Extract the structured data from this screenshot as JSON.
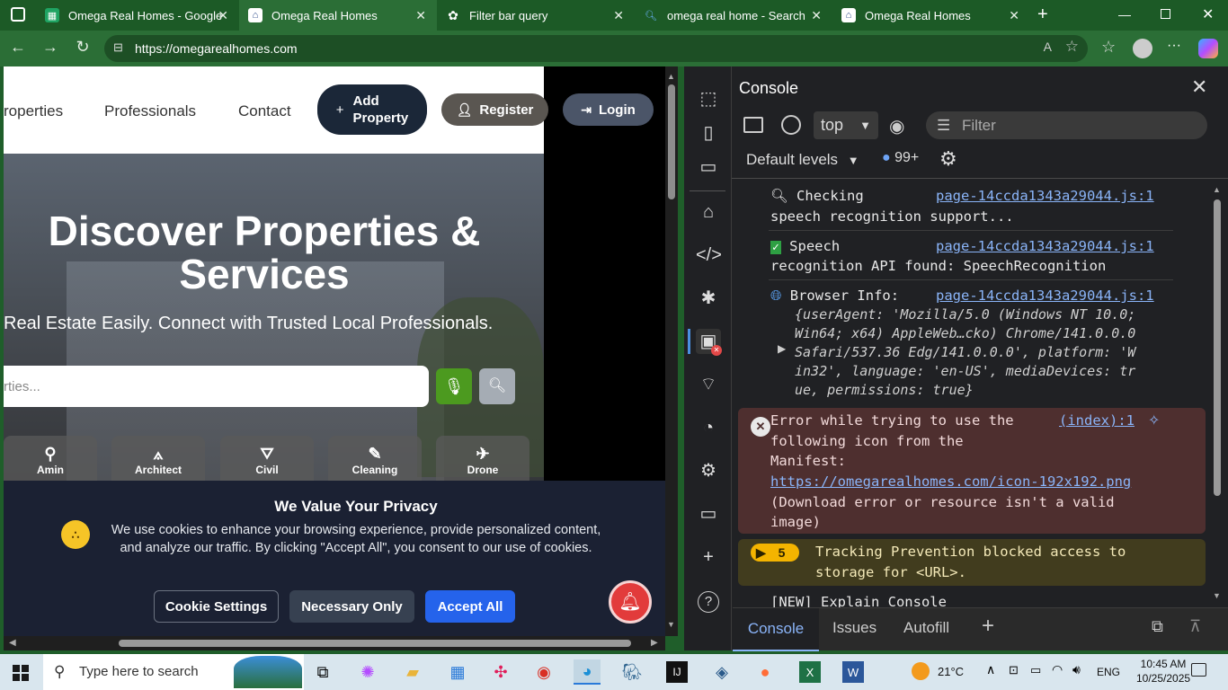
{
  "browser": {
    "tabs": [
      {
        "label": "Omega Real Homes - Google",
        "icon": "sheets-icon"
      },
      {
        "label": "Omega Real Homes",
        "icon": "site-icon"
      },
      {
        "label": "Filter bar query",
        "icon": "chatgpt-icon"
      },
      {
        "label": "omega real home - Search",
        "icon": "search-icon"
      },
      {
        "label": "Omega Real Homes",
        "icon": "site-icon"
      }
    ],
    "url": "https://omegarealhomes.com"
  },
  "site": {
    "nav": {
      "properties": "roperties",
      "professionals": "Professionals",
      "contact": "Contact",
      "add_property_line1": "Add",
      "add_property_line2": "Property",
      "register": "Register",
      "login": "Login"
    },
    "hero": {
      "title_line1": "Discover Properties &",
      "title_line2": "Services",
      "subtitle": "Real Estate Easily. Connect with Trusted Local Professionals.",
      "search_placeholder": "rties..."
    },
    "categories": [
      "Amin",
      "Architect",
      "Civil",
      "Cleaning",
      "Drone"
    ],
    "cookie": {
      "title": "We Value Your Privacy",
      "text": "We use cookies to enhance your browsing experience, provide personalized content, and analyze our traffic. By clicking \"Accept All\", you consent to our use of cookies.",
      "settings": "Cookie Settings",
      "necessary": "Necessary Only",
      "accept": "Accept All"
    }
  },
  "devtools": {
    "title": "Console",
    "context": "top",
    "filter_placeholder": "Filter",
    "levels": "Default levels",
    "count": "99+",
    "logs": {
      "l1_text": "Checking",
      "l1_src": "page-14ccda1343a29044.js:1",
      "l1_cont": "speech recognition support...",
      "l2_text": "Speech",
      "l2_src": "page-14ccda1343a29044.js:1",
      "l2_cont": "recognition API found: SpeechRecognition",
      "l3_text": "Browser Info:",
      "l3_src": "page-14ccda1343a29044.js:1",
      "l3_a": "{userAgent: 'Mozilla/5.0 (Windows NT 10.0;",
      "l3_b": "Win64; x64) AppleWeb…cko) Chrome/141.0.0.0",
      "l3_c": "Safari/537.36 Edg/141.0.0.0', platform: 'W",
      "l3_d": "in32', language: 'en-US', mediaDevices: tr",
      "l3_e": "ue, permissions: true}",
      "err_a": "Error while trying to use the",
      "err_src": "(index):1",
      "err_b": "following icon from the",
      "err_c": "Manifest:",
      "err_link": "https://omegarealhomes.com/icon-192x192.png",
      "err_d": "(Download error or resource isn't a valid",
      "err_e": "image)",
      "warn_count": "5",
      "warn_a": "Tracking Prevention blocked access to",
      "warn_b": "storage for <URL>.",
      "explain": "[NEW] Explain Console"
    },
    "bottom_tabs": [
      "Console",
      "Issues",
      "Autofill"
    ]
  },
  "taskbar": {
    "search_placeholder": "Type here to search",
    "temp": "21°C",
    "lang": "ENG",
    "time": "10:45 AM",
    "date": "10/25/2025"
  }
}
